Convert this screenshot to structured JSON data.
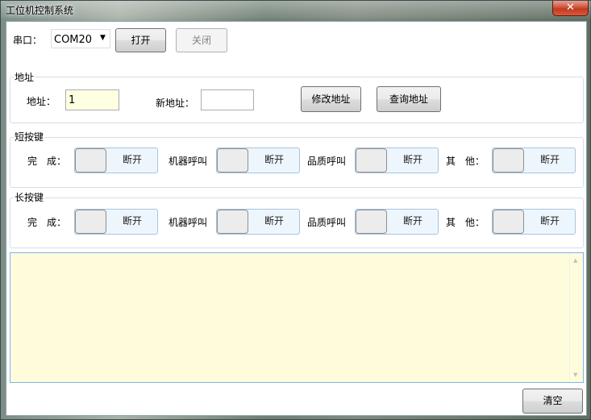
{
  "window": {
    "title": "工位机控制系统",
    "close_glyph": "✕"
  },
  "serial": {
    "label": "串口：",
    "port": "COM20",
    "open_label": "打开",
    "close_label": "关闭"
  },
  "address": {
    "group_title": "地址",
    "addr_label": "地址：",
    "addr_value": "1",
    "new_addr_label": "新地址：",
    "new_addr_value": "",
    "modify_button": "修改地址",
    "query_button": "查询地址"
  },
  "short_press": {
    "group_title": "短按键",
    "items": [
      {
        "label": "完　成：",
        "state": "断开"
      },
      {
        "label": "机器呼叫",
        "state": "断开"
      },
      {
        "label": "品质呼叫",
        "state": "断开"
      },
      {
        "label": "其　他：",
        "state": "断开"
      }
    ]
  },
  "long_press": {
    "group_title": "长按键",
    "items": [
      {
        "label": "完　成：",
        "state": "断开"
      },
      {
        "label": "机器呼叫",
        "state": "断开"
      },
      {
        "label": "品质呼叫",
        "state": "断开"
      },
      {
        "label": "其　他：",
        "state": "断开"
      }
    ]
  },
  "log": {
    "content": ""
  },
  "footer": {
    "clear_button": "清空"
  }
}
